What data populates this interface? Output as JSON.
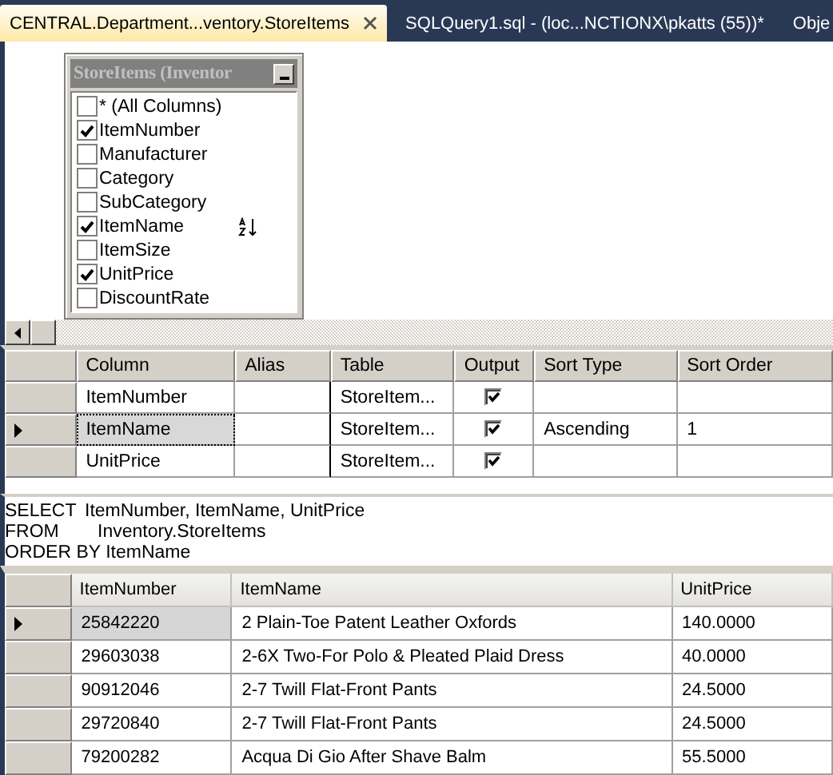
{
  "tabs": [
    {
      "label": "CENTRAL.Department...ventory.StoreItems",
      "selected": true
    },
    {
      "label": "SQLQuery1.sql - (loc...NCTIONX\\pkatts (55))*",
      "selected": false
    },
    {
      "label": "Obje",
      "selected": false
    }
  ],
  "diagram_table": {
    "title": "StoreItems (Inventor",
    "columns": [
      {
        "name": "* (All Columns)",
        "checked": false,
        "sorted": false
      },
      {
        "name": "ItemNumber",
        "checked": true,
        "sorted": false
      },
      {
        "name": "Manufacturer",
        "checked": false,
        "sorted": false
      },
      {
        "name": "Category",
        "checked": false,
        "sorted": false
      },
      {
        "name": "SubCategory",
        "checked": false,
        "sorted": false
      },
      {
        "name": "ItemName",
        "checked": true,
        "sorted": true
      },
      {
        "name": "ItemSize",
        "checked": false,
        "sorted": false
      },
      {
        "name": "UnitPrice",
        "checked": true,
        "sorted": false
      },
      {
        "name": "DiscountRate",
        "checked": false,
        "sorted": false
      }
    ]
  },
  "criteria_grid": {
    "columns": [
      "Column",
      "Alias",
      "Table",
      "Output",
      "Sort Type",
      "Sort Order"
    ],
    "rows": [
      {
        "column": "ItemNumber",
        "alias": "",
        "table": "StoreItem...",
        "output": true,
        "sort_type": "",
        "sort_order": "",
        "selected": false
      },
      {
        "column": "ItemName",
        "alias": "",
        "table": "StoreItem...",
        "output": true,
        "sort_type": "Ascending",
        "sort_order": "1",
        "selected": true
      },
      {
        "column": "UnitPrice",
        "alias": "",
        "table": "StoreItem...",
        "output": true,
        "sort_type": "",
        "sort_order": "",
        "selected": false
      }
    ]
  },
  "sql": [
    {
      "keyword": "SELECT",
      "text": "ItemNumber, ItemName, UnitPrice"
    },
    {
      "keyword": "FROM",
      "text": "Inventory.StoreItems"
    },
    {
      "keyword": "ORDER BY",
      "text": "ItemName"
    }
  ],
  "results": {
    "columns": [
      "ItemNumber",
      "ItemName",
      "UnitPrice"
    ],
    "rows": [
      {
        "cells": [
          "25842220",
          "2 Plain-Toe Patent Leather Oxfords",
          "140.0000"
        ],
        "selected": true
      },
      {
        "cells": [
          "29603038",
          "2-6X Two-For Polo & Pleated Plaid Dress",
          "40.0000"
        ],
        "selected": false
      },
      {
        "cells": [
          "90912046",
          "2-7 Twill Flat-Front Pants",
          "24.5000"
        ],
        "selected": false
      },
      {
        "cells": [
          "29720840",
          "2-7 Twill Flat-Front Pants",
          "24.5000"
        ],
        "selected": false
      },
      {
        "cells": [
          "79200282",
          "Acqua Di Gio After Shave Balm",
          "55.5000"
        ],
        "selected": false
      }
    ]
  }
}
